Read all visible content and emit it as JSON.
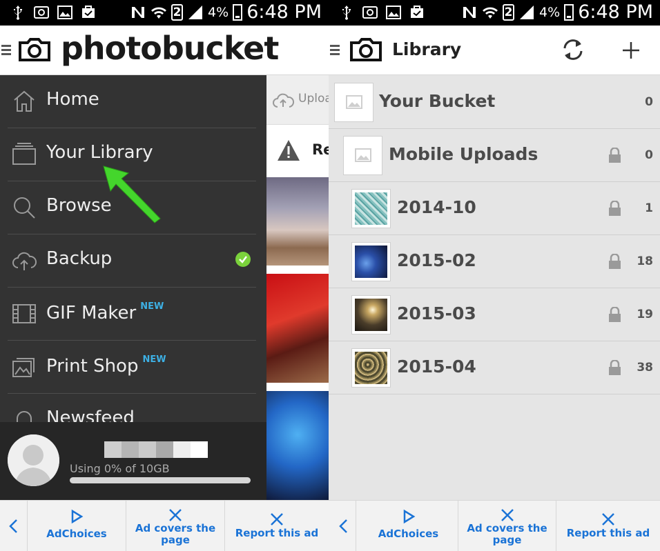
{
  "status_bar": {
    "battery": "4%",
    "time": "6:48 PM",
    "sim": "2"
  },
  "left_panel": {
    "app_logo_text": "photobucket",
    "drawer": {
      "items": [
        {
          "label": "Home",
          "icon": "home-icon"
        },
        {
          "label": "Your Library",
          "icon": "library-icon"
        },
        {
          "label": "Browse",
          "icon": "search-icon"
        },
        {
          "label": "Backup",
          "icon": "cloud-upload-icon",
          "status": "checked"
        },
        {
          "label": "GIF Maker",
          "icon": "film-icon",
          "badge": "NEW"
        },
        {
          "label": "Print Shop",
          "icon": "photos-icon",
          "badge": "NEW"
        },
        {
          "label": "Newsfeed",
          "icon": "bell-icon"
        }
      ],
      "profile": {
        "usage_text": "Using 0% of 10GB",
        "usage_fraction": 0
      }
    },
    "peek": {
      "upload_label": "Uploa",
      "warning_label": "Re"
    }
  },
  "right_panel": {
    "title": "Library",
    "rows": [
      {
        "title": "Your Bucket",
        "count": "0",
        "locked": false,
        "thumb": "placeholder"
      },
      {
        "title": "Mobile Uploads",
        "count": "0",
        "locked": true,
        "thumb": "placeholder"
      },
      {
        "title": "2014-10",
        "count": "1",
        "locked": true,
        "thumb": "photo"
      },
      {
        "title": "2015-02",
        "count": "18",
        "locked": true,
        "thumb": "photo"
      },
      {
        "title": "2015-03",
        "count": "19",
        "locked": true,
        "thumb": "photo"
      },
      {
        "title": "2015-04",
        "count": "38",
        "locked": true,
        "thumb": "photo"
      }
    ]
  },
  "ad_bar": {
    "adchoices": "AdChoices",
    "covers_line1": "Ad covers the",
    "covers_line2": "page",
    "report": "Report this ad"
  },
  "colors": {
    "drawer_bg": "#333333",
    "accent_blue": "#1a73d6",
    "new_badge": "#3db0e4",
    "check_green": "#7bd23c",
    "arrow_green": "#44d62c"
  }
}
